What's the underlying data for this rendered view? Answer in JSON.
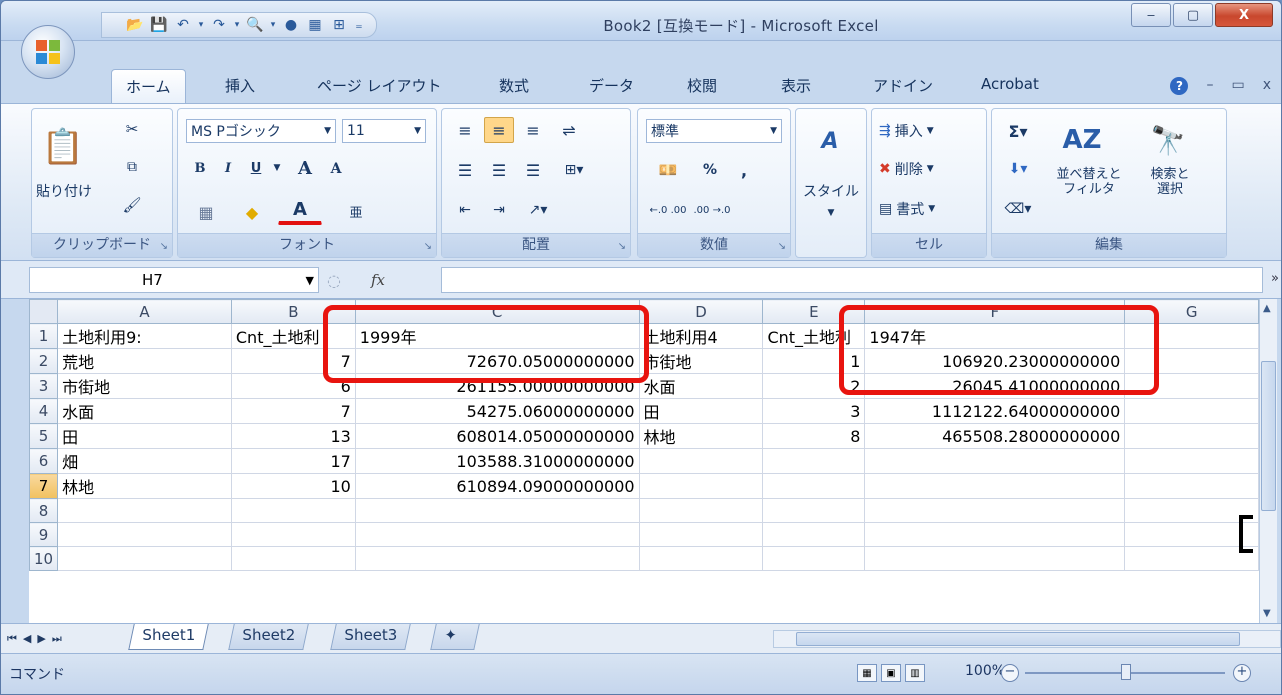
{
  "window": {
    "title": "Book2 [互換モード] - Microsoft Excel",
    "minimize": "‒",
    "maximize": "▢",
    "close": "X"
  },
  "qat": {
    "customize": "₌"
  },
  "tabs": [
    {
      "label": "ホーム",
      "active": true
    },
    {
      "label": "挿入"
    },
    {
      "label": "ページ レイアウト"
    },
    {
      "label": "数式"
    },
    {
      "label": "データ"
    },
    {
      "label": "校閲"
    },
    {
      "label": "表示"
    },
    {
      "label": "アドイン"
    },
    {
      "label": "Acrobat"
    }
  ],
  "ribbon": {
    "clipboard": {
      "paste": "貼り付け",
      "label": "クリップボード"
    },
    "font": {
      "name": "MS Pゴシック",
      "size": "11",
      "bold": "B",
      "italic": "I",
      "underline": "U",
      "grow": "A",
      "shrink": "A",
      "font_color": "A",
      "label": "フォント"
    },
    "alignment": {
      "label": "配置"
    },
    "number": {
      "format": "標準",
      "percent": "%",
      "comma": ",",
      "inc": "←.0 .00",
      "dec": ".00 →.0",
      "label": "数値"
    },
    "styles": {
      "label": "スタイル"
    },
    "cells": {
      "insert": "挿入",
      "delete": "削除",
      "format": "書式",
      "label": "セル"
    },
    "editing": {
      "sort": "並べ替えと\nフィルタ",
      "find": "検索と\n選択",
      "label": "編集"
    }
  },
  "formula_bar": {
    "name_box": "H7",
    "fx": "fx",
    "content": ""
  },
  "grid": {
    "columns": [
      "A",
      "B",
      "C",
      "D",
      "E",
      "F",
      "G"
    ],
    "selected_row": "7",
    "rows": [
      {
        "n": "1",
        "A": "土地利用9:",
        "B": "Cnt_土地利",
        "C": "1999年",
        "D": "土地利用4",
        "E": "Cnt_土地利",
        "F": "1947年",
        "G": ""
      },
      {
        "n": "2",
        "A": "荒地",
        "B": "7",
        "C": "72670.05000000000",
        "D": "市街地",
        "E": "1",
        "F": "106920.23000000000",
        "G": ""
      },
      {
        "n": "3",
        "A": "市街地",
        "B": "6",
        "C": "261155.00000000000",
        "D": "水面",
        "E": "2",
        "F": "26045.41000000000",
        "G": ""
      },
      {
        "n": "4",
        "A": "水面",
        "B": "7",
        "C": "54275.06000000000",
        "D": "田",
        "E": "3",
        "F": "1112122.64000000000",
        "G": ""
      },
      {
        "n": "5",
        "A": "田",
        "B": "13",
        "C": "608014.05000000000",
        "D": "林地",
        "E": "8",
        "F": "465508.28000000000",
        "G": ""
      },
      {
        "n": "6",
        "A": "畑",
        "B": "17",
        "C": "103588.31000000000",
        "D": "",
        "E": "",
        "F": "",
        "G": ""
      },
      {
        "n": "7",
        "A": "林地",
        "B": "10",
        "C": "610894.09000000000",
        "D": "",
        "E": "",
        "F": "",
        "G": ""
      },
      {
        "n": "8",
        "A": "",
        "B": "",
        "C": "",
        "D": "",
        "E": "",
        "F": "",
        "G": ""
      },
      {
        "n": "9",
        "A": "",
        "B": "",
        "C": "",
        "D": "",
        "E": "",
        "F": "",
        "G": ""
      },
      {
        "n": "10",
        "A": "",
        "B": "",
        "C": "",
        "D": "",
        "E": "",
        "F": "",
        "G": ""
      }
    ]
  },
  "sheets": [
    {
      "label": "Sheet1",
      "active": true
    },
    {
      "label": "Sheet2"
    },
    {
      "label": "Sheet3"
    }
  ],
  "status": {
    "mode": "コマンド",
    "zoom": "100%",
    "zoom_out": "−",
    "zoom_in": "+"
  },
  "colors": {
    "highlight": "#e8140f",
    "ribbon": "#dde8f5",
    "accent": "#2f68c2"
  }
}
